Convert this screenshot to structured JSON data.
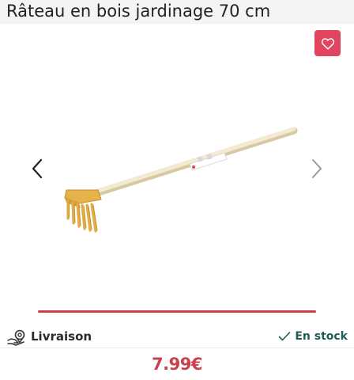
{
  "product": {
    "title": "Râteau en bois jardinage 70 cm",
    "price": "7.99€"
  },
  "favorite": {
    "icon": "heart-outline-icon",
    "color": "#e0445f"
  },
  "carousel": {
    "prev_icon": "chevron-left-icon",
    "next_icon": "chevron-right-icon",
    "progress_fraction": 1.0,
    "progress_color": "#c8414b"
  },
  "delivery": {
    "label": "Livraison",
    "icon": "delivery-pin-icon"
  },
  "stock": {
    "label": "En stock",
    "icon": "check-icon",
    "color": "#1f5d54"
  }
}
